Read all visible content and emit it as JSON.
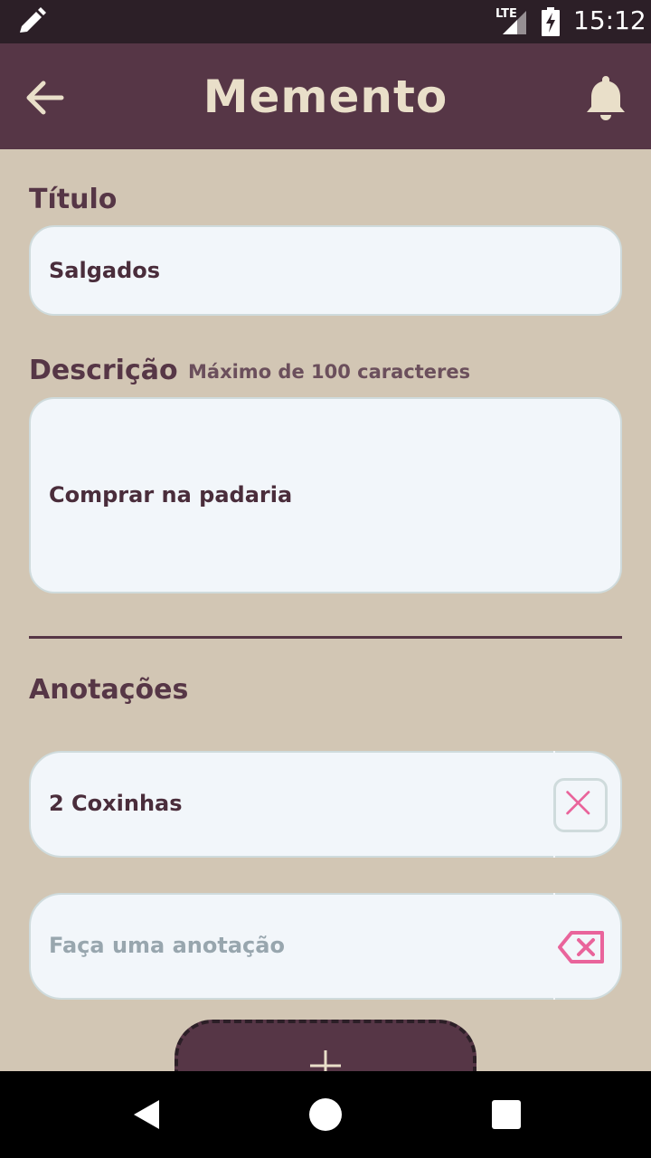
{
  "status_bar": {
    "network": "LTE",
    "time": "15:12"
  },
  "app_bar": {
    "title": "Memento"
  },
  "form": {
    "titulo_label": "Título",
    "titulo_value": "Salgados",
    "descricao_label": "Descrição",
    "descricao_hint": "Máximo de 100 caracteres",
    "descricao_value": "Comprar na padaria",
    "anotacoes_label": "Anotações"
  },
  "notes": [
    {
      "text": "2 Coxinhas"
    }
  ],
  "new_note": {
    "placeholder": "Faça uma anotação"
  },
  "colors": {
    "background": "#d2c6b4",
    "primary": "#563646",
    "field": "#f2f6fa",
    "accent_pink": "#e9649b",
    "title_text": "#e9dfc9"
  }
}
